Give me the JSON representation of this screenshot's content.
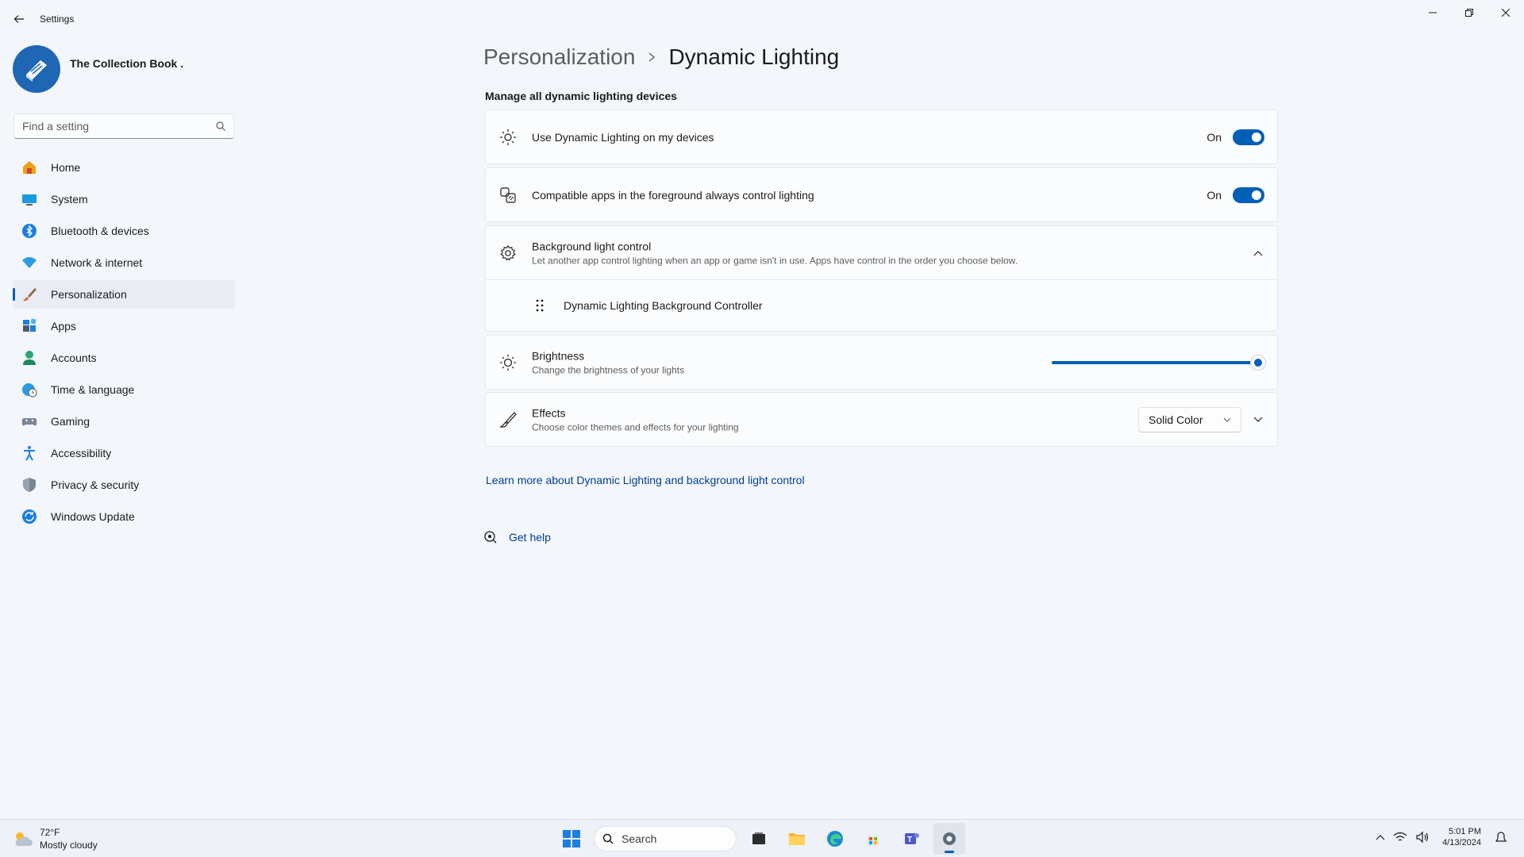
{
  "window": {
    "title": "Settings",
    "controls": {
      "minimize": "minimize-icon",
      "restore": "restore-icon",
      "close": "close-icon"
    }
  },
  "profile": {
    "name": "The Collection Book ."
  },
  "search": {
    "placeholder": "Find a setting"
  },
  "sidebar": {
    "items": [
      {
        "label": "Home",
        "icon": "home-icon"
      },
      {
        "label": "System",
        "icon": "system-icon"
      },
      {
        "label": "Bluetooth & devices",
        "icon": "bluetooth-icon"
      },
      {
        "label": "Network & internet",
        "icon": "wifi-icon"
      },
      {
        "label": "Personalization",
        "icon": "brush-icon",
        "active": true
      },
      {
        "label": "Apps",
        "icon": "apps-icon"
      },
      {
        "label": "Accounts",
        "icon": "accounts-icon"
      },
      {
        "label": "Time & language",
        "icon": "globe-clock-icon"
      },
      {
        "label": "Gaming",
        "icon": "gamepad-icon"
      },
      {
        "label": "Accessibility",
        "icon": "accessibility-icon"
      },
      {
        "label": "Privacy & security",
        "icon": "shield-icon"
      },
      {
        "label": "Windows Update",
        "icon": "update-icon"
      }
    ]
  },
  "breadcrumb": {
    "parent": "Personalization",
    "current": "Dynamic Lighting"
  },
  "section": {
    "title": "Manage all dynamic lighting devices"
  },
  "settings": {
    "use_dynamic": {
      "title": "Use Dynamic Lighting on my devices",
      "state": "On"
    },
    "foreground": {
      "title": "Compatible apps in the foreground always control lighting",
      "state": "On"
    },
    "background": {
      "title": "Background light control",
      "desc": "Let another app control lighting when an app or game isn't in use. Apps have control in the order you choose below.",
      "controller": "Dynamic Lighting Background Controller"
    },
    "brightness": {
      "title": "Brightness",
      "desc": "Change the brightness of your lights",
      "value": 1.0
    },
    "effects": {
      "title": "Effects",
      "desc": "Choose color themes and effects for your lighting",
      "selected": "Solid Color"
    }
  },
  "links": {
    "learn_more": "Learn more about Dynamic Lighting and background light control",
    "get_help": "Get help"
  },
  "taskbar": {
    "weather_temp": "72°F",
    "weather_desc": "Mostly cloudy",
    "search_label": "Search",
    "time": "5:01 PM",
    "date": "4/13/2024"
  },
  "colors": {
    "accent": "#005fb8",
    "background": "#f3f6fb",
    "card": "#fbfcfe"
  }
}
